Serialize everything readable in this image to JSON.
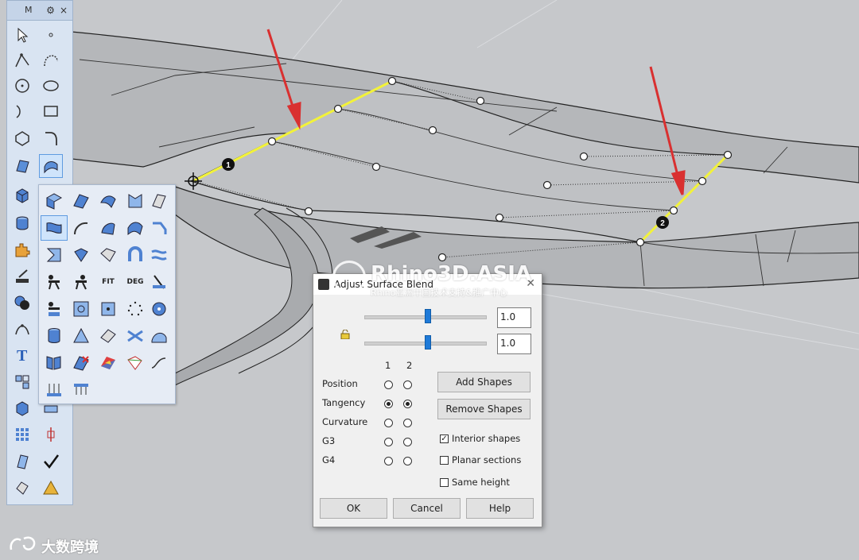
{
  "toolbar": {
    "title_letter": "M",
    "settings_glyph": "⚙",
    "close_glyph": "×"
  },
  "popup": {
    "fit_label": "FIT",
    "deg_label": "DEG"
  },
  "markers": {
    "point1": "1",
    "point2": "2"
  },
  "dialog": {
    "title": "Adjust Surface Blend",
    "close_glyph": "✕",
    "slider1_value": "1.0",
    "slider2_value": "1.0",
    "slider1_level": 0.5,
    "slider2_level": 0.5,
    "col1": "1",
    "col2": "2",
    "rows": [
      {
        "label": "Position",
        "r1": false,
        "r2": false
      },
      {
        "label": "Tangency",
        "r1": true,
        "r2": true
      },
      {
        "label": "Curvature",
        "r1": false,
        "r2": false
      },
      {
        "label": "G3",
        "r1": false,
        "r2": false
      },
      {
        "label": "G4",
        "r1": false,
        "r2": false
      }
    ],
    "add_shapes": "Add Shapes",
    "remove_shapes": "Remove Shapes",
    "interior_shapes": {
      "label": "Interior shapes",
      "checked": true
    },
    "planar_sections": {
      "label": "Planar sections",
      "checked": false
    },
    "same_height": {
      "label": "Same height",
      "checked": false
    },
    "ok": "OK",
    "cancel": "Cancel",
    "help": "Help"
  },
  "watermark": {
    "brand": "Rhino3D.ASIA",
    "subtitle": "Rhino亚洲中国技术支持&推广中心",
    "corner": "大数跨境"
  },
  "colors": {
    "accent_blue": "#1e7ad8",
    "arrow_red": "#d93030",
    "highlight_yellow": "#f2f23a"
  }
}
